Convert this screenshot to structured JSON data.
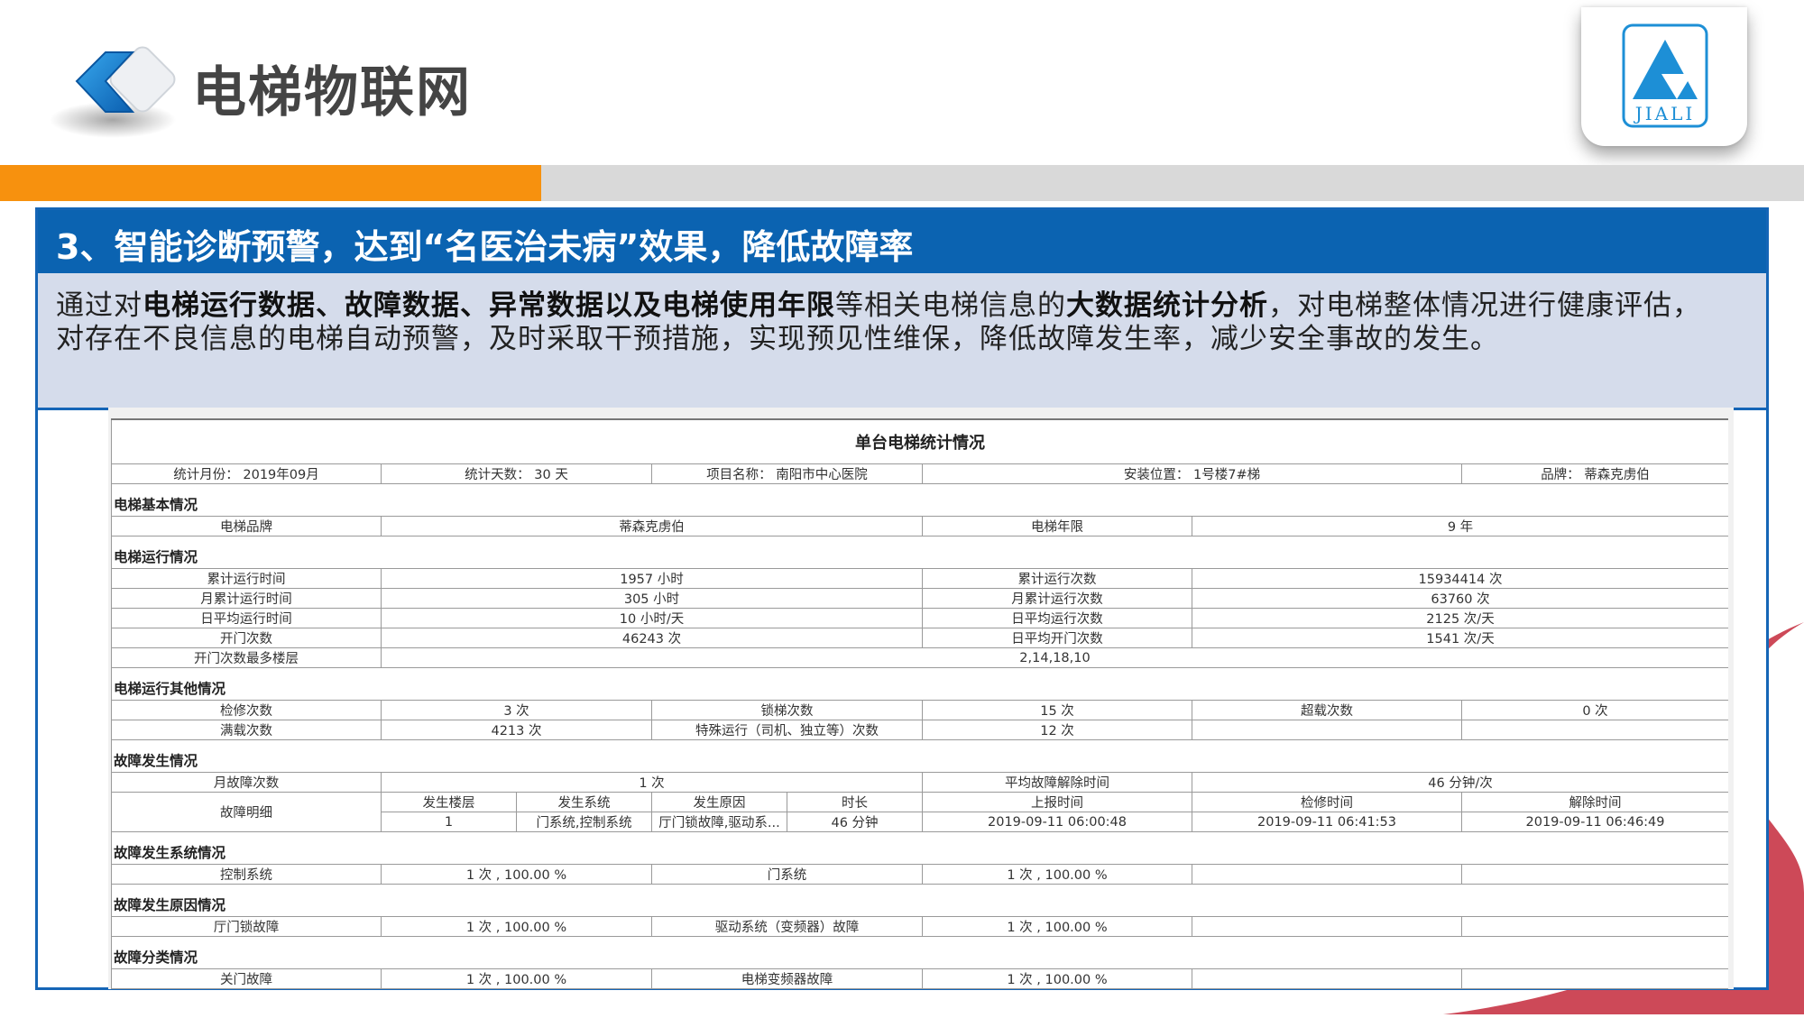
{
  "header": {
    "title": "电梯物联网",
    "brand_logo_text": "JIALI",
    "logo_icon": "chevron-diamond-icon"
  },
  "progress": {
    "value_percent": 30
  },
  "colors": {
    "accent_orange": "#f7910e",
    "section_blue": "#0b63b1",
    "desc_bg": "#d5dceb",
    "deco_red": "#c9394a"
  },
  "section": {
    "title": "3、智能诊断预警，达到“名医治未病”效果，降低故障率",
    "desc_1": "通过对",
    "desc_2": "电梯运行数据、故障数据、异常数据以及电梯使用年限",
    "desc_3": "等相关电梯信息的",
    "desc_4": "大数据统计分析",
    "desc_5": "，对电梯整体情况进行健康评估，对存在不良信息的电梯自动预警，及时采取干预措施，实现预见性维保，降低故障发生率，减少安全事故的发生。"
  },
  "report": {
    "title": "单台电梯统计情况",
    "meta": {
      "month": "统计月份：  2019年09月",
      "days": "统计天数：  30 天",
      "project": "项目名称：  南阳市中心医院",
      "location": "安装位置：  1号楼7#梯",
      "brand": "品牌：  蒂森克虏伯"
    },
    "basic": {
      "heading": "电梯基本情况",
      "brand_label": "电梯品牌",
      "brand_value": "蒂森克虏伯",
      "age_label": "电梯年限",
      "age_value": "9 年"
    },
    "operation": {
      "heading": "电梯运行情况",
      "rows": [
        {
          "l1": "累计运行时间",
          "v1": "1957 小时",
          "l2": "累计运行次数",
          "v2": "15934414 次"
        },
        {
          "l1": "月累计运行时间",
          "v1": "305 小时",
          "l2": "月累计运行次数",
          "v2": "63760 次"
        },
        {
          "l1": "日平均运行时间",
          "v1": "10 小时/天",
          "l2": "日平均运行次数",
          "v2": "2125 次/天"
        },
        {
          "l1": "开门次数",
          "v1": "46243 次",
          "l2": "日平均开门次数",
          "v2": "1541 次/天"
        }
      ],
      "floor_label": "开门次数最多楼层",
      "floor_value": "2,14,18,10"
    },
    "other": {
      "heading": "电梯运行其他情况",
      "row1": {
        "a": "检修次数",
        "b": "3 次",
        "c": "锁梯次数",
        "d": "15 次",
        "e": "超载次数",
        "f": "0 次"
      },
      "row2": {
        "a": "满载次数",
        "b": "4213 次",
        "c": "特殊运行（司机、独立等）次数",
        "d": "12 次"
      }
    },
    "fault": {
      "heading": "故障发生情况",
      "month_label": "月故障次数",
      "month_value": "1 次",
      "avg_label": "平均故障解除时间",
      "avg_value": "46 分钟/次",
      "detail_label": "故障明细",
      "headers": [
        "发生楼层",
        "发生系统",
        "发生原因",
        "时长",
        "上报时间",
        "检修时间",
        "解除时间"
      ],
      "row": [
        "1",
        "门系统,控制系统",
        "厅门锁故障,驱动系...",
        "46 分钟",
        "2019-09-11 06:00:48",
        "2019-09-11 06:41:53",
        "2019-09-11 06:46:49"
      ]
    },
    "fault_system": {
      "heading": "故障发生系统情况",
      "a": "控制系统",
      "b": "1 次 , 100.00 %",
      "c": "门系统",
      "d": "1 次 , 100.00 %"
    },
    "fault_reason": {
      "heading": "故障发生原因情况",
      "a": "厅门锁故障",
      "b": "1 次 , 100.00 %",
      "c": "驱动系统（变频器）故障",
      "d": "1 次 , 100.00 %"
    },
    "fault_class": {
      "heading": "故障分类情况",
      "a": "关门故障",
      "b": "1 次 , 100.00 %",
      "c": "电梯变频器故障",
      "d": "1 次 , 100.00 %"
    }
  }
}
